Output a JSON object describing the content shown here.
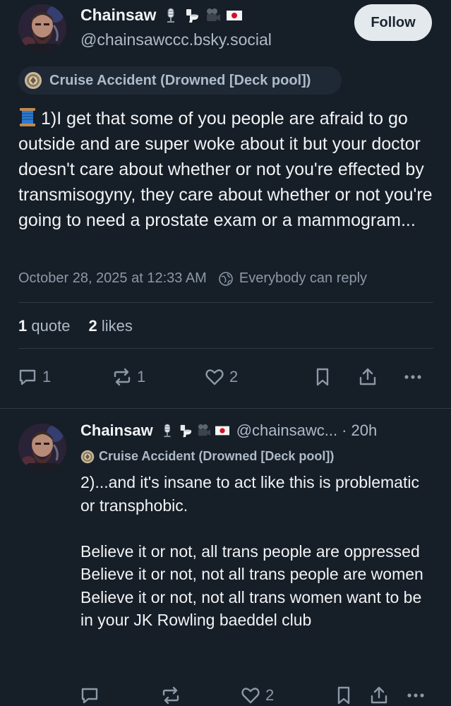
{
  "main_post": {
    "author": {
      "display_name": "Chainsaw",
      "handle": "@chainsawccc.bsky.social",
      "emojis": [
        "microphone-icon",
        "toilet-icon",
        "movie-camera-icon",
        "japan-flag-icon"
      ]
    },
    "follow_label": "Follow",
    "label": "Cruise Accident (Drowned [Deck pool])",
    "text_emoji": "thread-spool-icon",
    "text": "1)I get that some of you people are afraid to go outside and are super woke about it but your doctor doesn't care about whether or not you're effected by transmisogyny, they care about whether or not you're going to need a prostate exam or a mammogram...",
    "timestamp": "October 28, 2025 at 12:33 AM",
    "reply_permission": "Everybody can reply",
    "stats": {
      "quotes_count": "1",
      "quotes_label": "quote",
      "likes_count": "2",
      "likes_label": "likes"
    },
    "actions": {
      "reply_count": "1",
      "repost_count": "1",
      "like_count": "2"
    }
  },
  "reply_post": {
    "author": {
      "display_name": "Chainsaw",
      "handle": "@chainsawc...",
      "emojis": [
        "microphone-icon",
        "toilet-icon",
        "movie-camera-icon",
        "japan-flag-icon"
      ]
    },
    "time": "· 20h",
    "label": "Cruise Accident (Drowned [Deck pool])",
    "lines": [
      "2)...and it's insane to act like this is problematic or transphobic.",
      "",
      "Believe it or not, all trans people are oppressed",
      "Believe it or not, not all trans people are women",
      "Believe it or not, not all trans women want to be in your JK Rowling baeddel club"
    ],
    "actions": {
      "reply_count": "",
      "repost_count": "",
      "like_count": "2"
    }
  },
  "colors": {
    "background": "#161e27",
    "text_primary": "#f1f3f5",
    "text_secondary": "#8b99a8",
    "follow_button": "#e4e9ee",
    "divider": "#2e3a47"
  }
}
